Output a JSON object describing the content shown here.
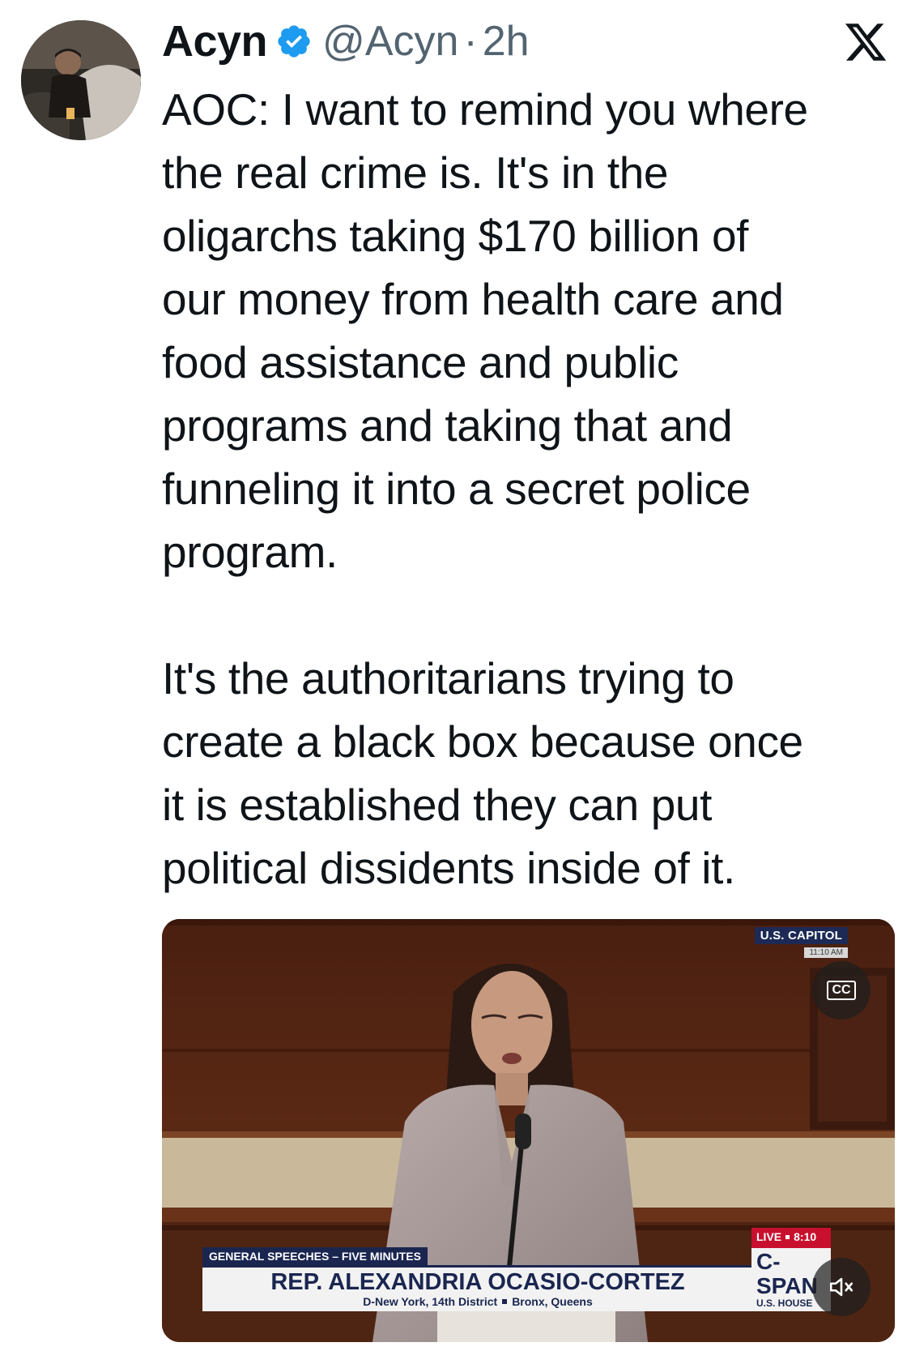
{
  "tweet": {
    "author_name": "Acyn",
    "handle": "@Acyn",
    "separator": "·",
    "time_ago": "2h",
    "verified": true,
    "paragraphs": [
      "AOC: I want to remind you where\nthe real crime is. It's in the\noligarchs taking $170 billion of\nour money from health care and\nfood assistance and public\nprograms and taking that and\nfunneling it into a secret police\nprogram.",
      "It's the authoritarians trying to\ncreate a black box because once\nit is established they can put\npolitical dissidents inside of it."
    ]
  },
  "icons": {
    "verified": "verified-badge-icon",
    "brand": "x-logo-icon",
    "captions": "closed-captions-icon",
    "volume": "volume-muted-icon"
  },
  "video": {
    "location_label": "U.S. CAPITOL",
    "location_time": "11:10 AM",
    "segment_label": "GENERAL SPEECHES – FIVE MINUTES",
    "speaker_name": "REP. ALEXANDRIA OCASIO-CORTEZ",
    "district_line": "D-New York, 14th District",
    "district_area": "Bronx, Queens",
    "live_label": "LIVE",
    "live_time": "8:10",
    "network": "C-SPAN",
    "network_sub": "U.S. HOUSE",
    "cc_label": "CC"
  },
  "colors": {
    "text_primary": "#0f1419",
    "text_secondary": "#536471",
    "verified_blue": "#1d9bf0",
    "cspan_navy": "#1a2650",
    "live_red": "#c8102e"
  }
}
